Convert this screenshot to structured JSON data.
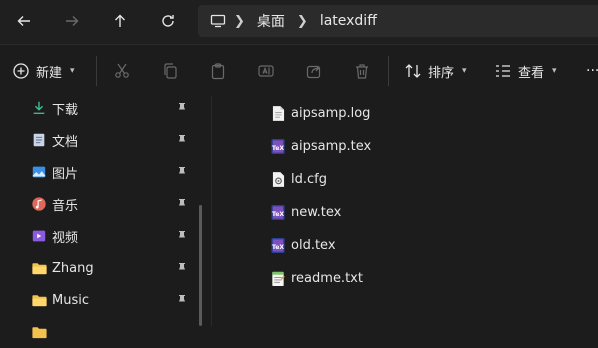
{
  "breadcrumb": {
    "desktop": "桌面",
    "folder": "latexdiff"
  },
  "toolbar": {
    "new_label": "新建",
    "sort_label": "排序",
    "view_label": "查看",
    "more": "···"
  },
  "sidebar": {
    "items": [
      {
        "label": "下载",
        "icon": "download-icon",
        "color": "#3fb98a"
      },
      {
        "label": "文档",
        "icon": "document-icon",
        "color": "#c9d4e6"
      },
      {
        "label": "图片",
        "icon": "pictures-icon",
        "color": "#3a8ee6"
      },
      {
        "label": "音乐",
        "icon": "music-icon",
        "color": "#e0685a"
      },
      {
        "label": "视频",
        "icon": "video-icon",
        "color": "#8a5ae0"
      },
      {
        "label": "Zhang",
        "icon": "folder-icon",
        "color": "#f2c14e"
      },
      {
        "label": "Music",
        "icon": "folder-icon",
        "color": "#f2c14e"
      }
    ]
  },
  "files": [
    {
      "name": "aipsamp.log",
      "icon": "text-file-icon"
    },
    {
      "name": "aipsamp.tex",
      "icon": "tex-file-icon"
    },
    {
      "name": "ld.cfg",
      "icon": "config-file-icon"
    },
    {
      "name": "new.tex",
      "icon": "tex-file-icon"
    },
    {
      "name": "old.tex",
      "icon": "tex-file-icon"
    },
    {
      "name": "readme.txt",
      "icon": "notepad-file-icon"
    }
  ]
}
